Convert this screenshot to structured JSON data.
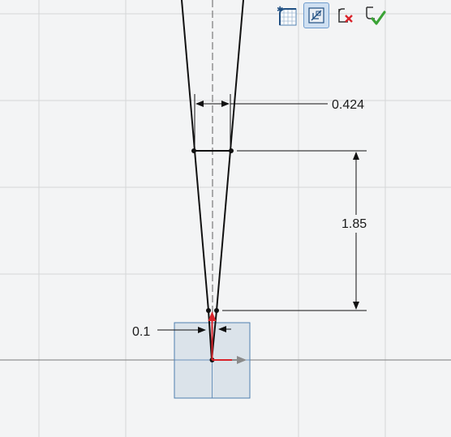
{
  "sketch": {
    "dimensions": {
      "top_width": "0.424",
      "height": "1.85",
      "bottom_width": "0.1"
    }
  },
  "toolbar": {
    "buttons": [
      {
        "icon": "grid-snap-icon",
        "active": false
      },
      {
        "icon": "sketch-view-icon",
        "active": true
      },
      {
        "icon": "cancel-sketch-icon",
        "active": false
      },
      {
        "icon": "finish-sketch-icon",
        "active": false
      }
    ]
  },
  "colors": {
    "background": "#f3f4f5",
    "grid": "#d4d6d8",
    "sketch_line": "#111111",
    "axis_red": "#d9232a",
    "axis_gray": "#8a8a8a",
    "plane_fill": "#d6dfe7",
    "plane_stroke": "#4f7fb0",
    "confirm_green": "#3aa335",
    "cancel_red": "#d9232a"
  }
}
